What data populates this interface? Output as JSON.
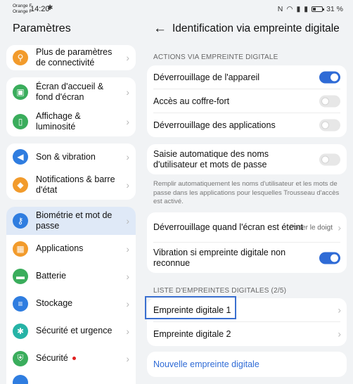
{
  "statusbar": {
    "carrier1": "Orange F",
    "carrier2": "Orange F",
    "time": "14:20",
    "battery": "31 %"
  },
  "left": {
    "title": "Paramètres",
    "items": [
      {
        "label": "Plus de paramètres de connectivité",
        "icon": "link-icon",
        "color": "#f29b2c"
      },
      {
        "label": "Écran d'accueil & fond d'écran",
        "icon": "image-icon",
        "color": "#3aad5c"
      },
      {
        "label": "Affichage & luminosité",
        "icon": "display-icon",
        "color": "#3aad5c"
      },
      {
        "label": "Son & vibration",
        "icon": "speaker-icon",
        "color": "#2f7de0"
      },
      {
        "label": "Notifications & barre d'état",
        "icon": "bell-icon",
        "color": "#f29b2c"
      },
      {
        "label": "Biométrie et mot de passe",
        "icon": "key-icon",
        "color": "#2f7de0"
      },
      {
        "label": "Applications",
        "icon": "apps-icon",
        "color": "#f29b2c"
      },
      {
        "label": "Batterie",
        "icon": "battery-icon",
        "color": "#3aad5c"
      },
      {
        "label": "Stockage",
        "icon": "storage-icon",
        "color": "#2f7de0"
      },
      {
        "label": "Sécurité et urgence",
        "icon": "asterisk-icon",
        "color": "#26b3a6"
      },
      {
        "label": "Sécurité",
        "icon": "shield-icon",
        "color": "#3aad5c"
      }
    ]
  },
  "right": {
    "title": "Identification via empreinte digitale",
    "section1": "ACTIONS VIA EMPREINTE DIGITALE",
    "unlock_device": "Déverrouillage de l'appareil",
    "vault": "Accès au coffre-fort",
    "unlock_apps": "Déverrouillage des applications",
    "autofill": "Saisie automatique des noms d'utilisateur et mots de passe",
    "autofill_desc": "Remplir automatiquement les noms d'utilisateur et les mots de passe dans les applications pour lesquelles Trousseau d'accès est activé.",
    "screen_off": "Déverrouillage quand l'écran est éteint",
    "screen_off_value": "Poser le doigt",
    "vibration": "Vibration si empreinte digitale non reconnue",
    "section2": "LISTE D'EMPREINTES DIGITALES (2/5)",
    "fp1": "Empreinte digitale 1",
    "fp2": "Empreinte digitale 2",
    "new_fp": "Nouvelle empreinte digitale"
  },
  "toggles": {
    "unlock_device": "on",
    "vault": "off",
    "unlock_apps": "off",
    "autofill": "off",
    "vibration": "on"
  }
}
